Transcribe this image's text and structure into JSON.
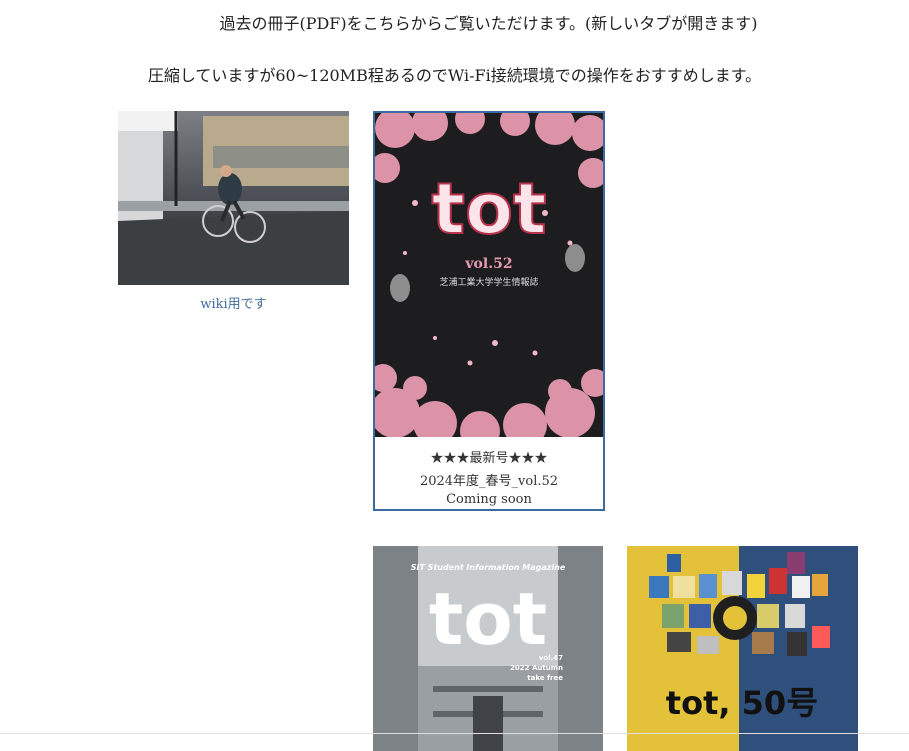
{
  "notices": {
    "line1": "過去の冊子(PDF)をこちらからご覧いただけます。(新しいタブが開きます)",
    "line2": "圧縮していますが60~120MB程あるのでWi-Fi接続環境での操作をおすすめします。"
  },
  "wiki_card": {
    "link": "wiki用です"
  },
  "featured": {
    "logo": "tot",
    "vol": "vol.52",
    "subtitle": "芝浦工業大学学生情報誌",
    "badge": "★★★最新号★★★",
    "issue": "2024年度_春号_vol.52",
    "status": "Coming soon"
  },
  "atrium": {
    "header": "SIT Student Information Magazine",
    "logo": "tot",
    "meta1": "vol.47",
    "meta2": "2022 Autumn",
    "meta3": "take free"
  },
  "fifty": {
    "logo": "tot",
    "headline": "tot, 50号"
  },
  "colors": {
    "link": "#3f6e9a",
    "featured_border": "#3b6aa3",
    "sakura": "#e79ab0"
  }
}
